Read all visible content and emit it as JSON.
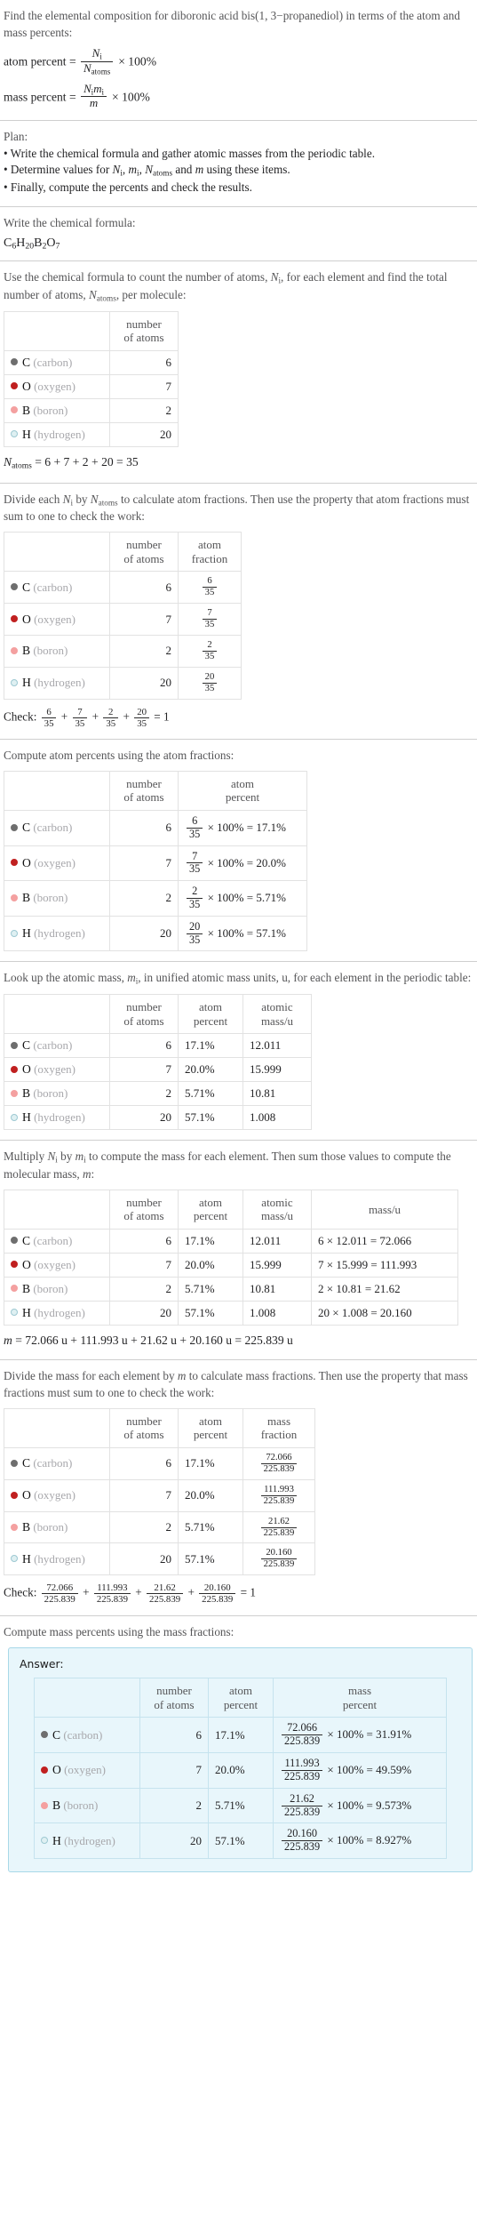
{
  "problem": {
    "statement": "Find the elemental composition for diboronic acid bis(1, 3−propanediol) in terms of the atom and mass percents:",
    "atom_percent_label": "atom percent = ",
    "mass_percent_label": "mass percent = ",
    "times_100": "× 100%"
  },
  "plan": {
    "heading": "Plan:",
    "bullets": [
      "• Write the chemical formula and gather atomic masses from the periodic table.",
      "• Finally, compute the percents and check the results."
    ],
    "bullet2_a": "• Determine values for ",
    "bullet2_b": " and ",
    "bullet2_c": " using these items."
  },
  "formula_section": {
    "heading": "Write the chemical formula:",
    "formula_parts": [
      {
        "sym": "C",
        "sub": "6"
      },
      {
        "sym": "H",
        "sub": "20"
      },
      {
        "sym": "B",
        "sub": "2"
      },
      {
        "sym": "O",
        "sub": "7"
      }
    ]
  },
  "count_section": {
    "text_a": "Use the chemical formula to count the number of atoms, ",
    "text_b": ", for each element and find the total number of atoms, ",
    "text_c": ", per molecule:",
    "natoms_line": "= 6 + 7 + 2 + 20 = 35"
  },
  "fraction_section": {
    "text": "Divide each N_i by N_atoms to calculate atom fractions. Then use the property that atom fractions must sum to one to check the work:",
    "text_a": "Divide each ",
    "text_b": " by ",
    "text_c": " to calculate atom fractions. Then use the property that atom fractions must sum to one to check the work:",
    "check_label": "Check:",
    "check_result": "= 1"
  },
  "atom_percent_section": {
    "heading": "Compute atom percents using the atom fractions:"
  },
  "atomic_mass_section": {
    "text_a": "Look up the atomic mass, ",
    "text_b": ", in unified atomic mass units, u, for each element in the periodic table:"
  },
  "mass_section": {
    "text_a": "Multiply ",
    "text_b": " by ",
    "text_c": " to compute the mass for each element. Then sum those values to compute the molecular mass, ",
    "text_d": ":",
    "molecular_mass_line": "= 72.066 u + 111.993 u + 21.62 u + 20.160 u = 225.839 u"
  },
  "mass_fraction_section": {
    "text_a": "Divide the mass for each element by ",
    "text_b": " to calculate mass fractions. Then use the property that mass fractions must sum to one to check the work:",
    "check_label": "Check:",
    "check_result": "= 1"
  },
  "mass_percent_section": {
    "heading": "Compute mass percents using the mass fractions:",
    "answer_label": "Answer:"
  },
  "headers": {
    "blank": "",
    "number_of_atoms": [
      "number",
      "of atoms"
    ],
    "atom_fraction": [
      "atom",
      "fraction"
    ],
    "atom_percent": [
      "atom",
      "percent"
    ],
    "atomic_mass": [
      "atomic",
      "mass/u"
    ],
    "mass_per_u": [
      "mass/u"
    ],
    "mass_fraction": [
      "mass",
      "fraction"
    ],
    "mass_percent": [
      "mass",
      "percent"
    ]
  },
  "colors": {
    "carbon": "#6e6e6e",
    "oxygen": "#c02020",
    "boron": "#f4a0a0",
    "hydrogen": "#dff0f2",
    "hydrogen_border": "#9dc8d2",
    "answer_bg": "#e8f6fb",
    "answer_border": "#a8d8e8",
    "rule": "#cfcfcf"
  },
  "elements": [
    {
      "symbol": "C",
      "name": "(carbon)",
      "color_key": "carbon",
      "count": "6",
      "fraction_num": "6",
      "fraction_den": "35",
      "atom_percent": "17.1%",
      "atom_percent_expr_result": "= 17.1%",
      "atomic_mass": "12.011",
      "mass_expr": "6 × 12.011 = 72.066",
      "mass_value": "72.066",
      "mass_den": "225.839",
      "mass_percent": "= 31.91%"
    },
    {
      "symbol": "O",
      "name": "(oxygen)",
      "color_key": "oxygen",
      "count": "7",
      "fraction_num": "7",
      "fraction_den": "35",
      "atom_percent": "20.0%",
      "atom_percent_expr_result": "= 20.0%",
      "atomic_mass": "15.999",
      "mass_expr": "7 × 15.999 = 111.993",
      "mass_value": "111.993",
      "mass_den": "225.839",
      "mass_percent": "= 49.59%"
    },
    {
      "symbol": "B",
      "name": "(boron)",
      "color_key": "boron",
      "count": "2",
      "fraction_num": "2",
      "fraction_den": "35",
      "atom_percent": "5.71%",
      "atom_percent_expr_result": "= 5.71%",
      "atomic_mass": "10.81",
      "mass_expr": "2 × 10.81 = 21.62",
      "mass_value": "21.62",
      "mass_den": "225.839",
      "mass_percent": "= 9.573%"
    },
    {
      "symbol": "H",
      "name": "(hydrogen)",
      "color_key": "hydrogen",
      "count": "20",
      "fraction_num": "20",
      "fraction_den": "35",
      "atom_percent": "57.1%",
      "atom_percent_expr_result": "= 57.1%",
      "atomic_mass": "1.008",
      "mass_expr": "20 × 1.008 = 20.160",
      "mass_value": "20.160",
      "mass_den": "225.839",
      "mass_percent": "= 8.927%"
    }
  ],
  "symbols": {
    "N": "N",
    "m": "m",
    "i_sub": "i",
    "atoms_sub": "atoms",
    "times100": "× 100%",
    "plus": "+",
    "equals": "="
  }
}
